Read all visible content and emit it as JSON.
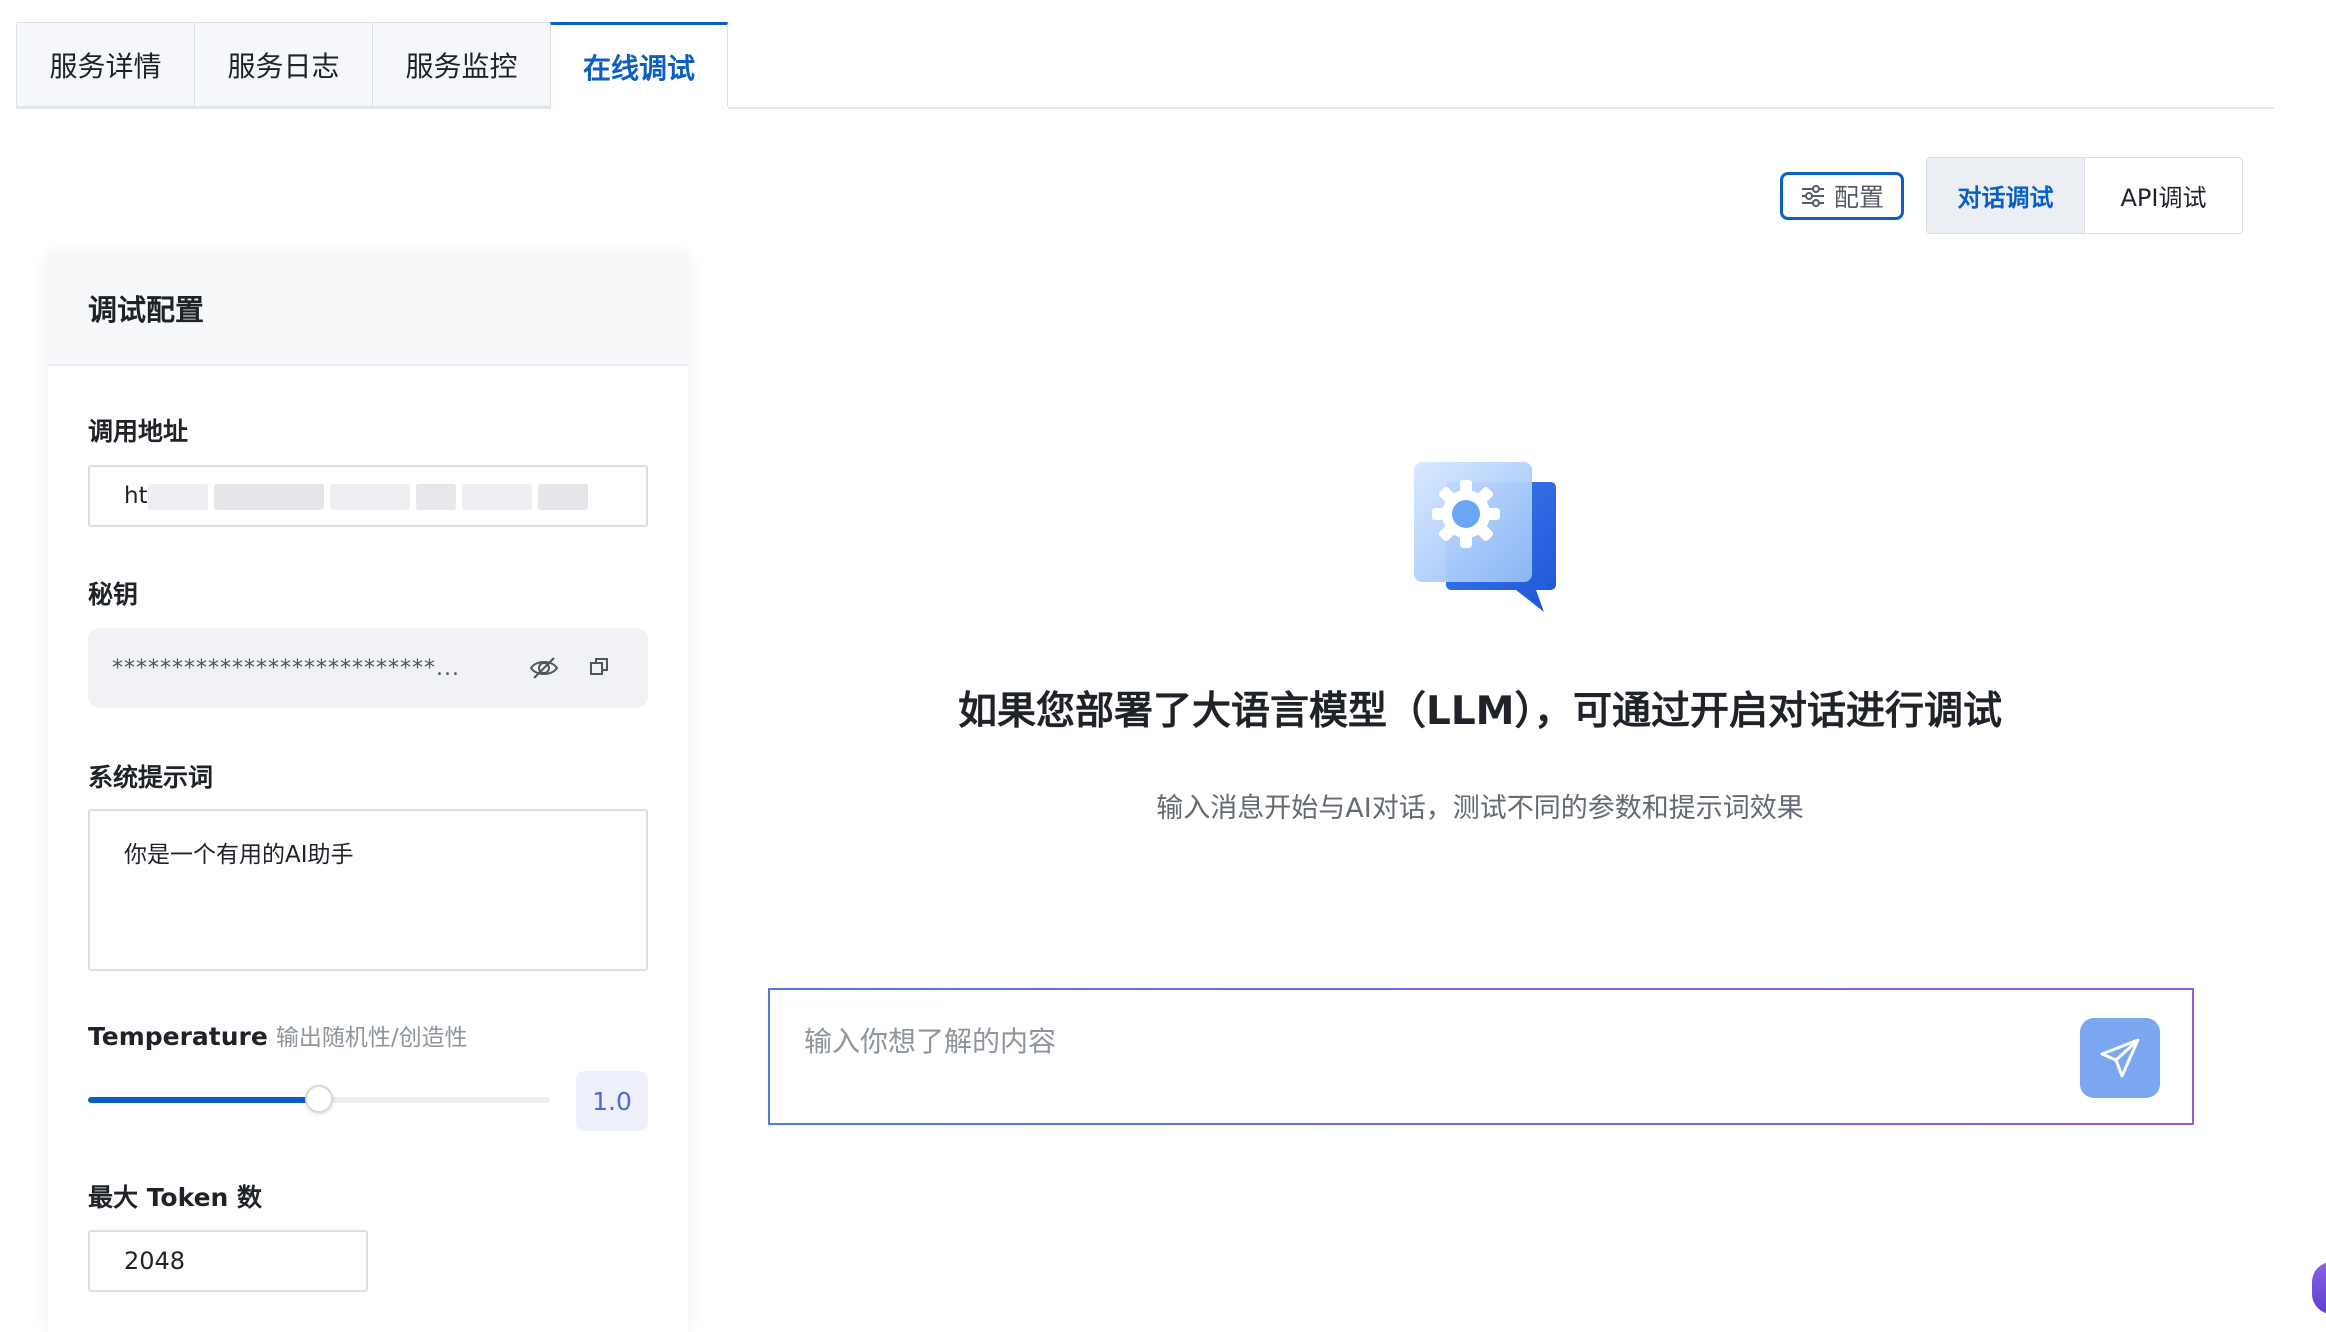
{
  "tabs": [
    {
      "label": "服务详情"
    },
    {
      "label": "服务日志"
    },
    {
      "label": "服务监控"
    },
    {
      "label": "在线调试"
    }
  ],
  "toolbar": {
    "config_label": "配置",
    "mode_chat": "对话调试",
    "mode_api": "API调试"
  },
  "panel": {
    "title": "调试配置",
    "url_label": "调用地址",
    "url_value": "ht",
    "secret_label": "秘钥",
    "secret_value": "***************************...",
    "system_prompt_label": "系统提示词",
    "system_prompt_value": "你是一个有用的AI助手",
    "temperature_label": "Temperature",
    "temperature_hint": "输出随机性/创造性",
    "temperature_value": "1.0",
    "temperature_fraction": 0.5,
    "max_tokens_label": "最大 Token 数",
    "max_tokens_value": "2048"
  },
  "main": {
    "title": "如果您部署了大语言模型（LLM），可通过开启对话进行调试",
    "subtitle": "输入消息开始与AI对话，测试不同的参数和提示词效果",
    "chat_placeholder": "输入你想了解的内容"
  },
  "colors": {
    "accent": "#0b5fc4",
    "send_button": "#7aa7ef"
  }
}
